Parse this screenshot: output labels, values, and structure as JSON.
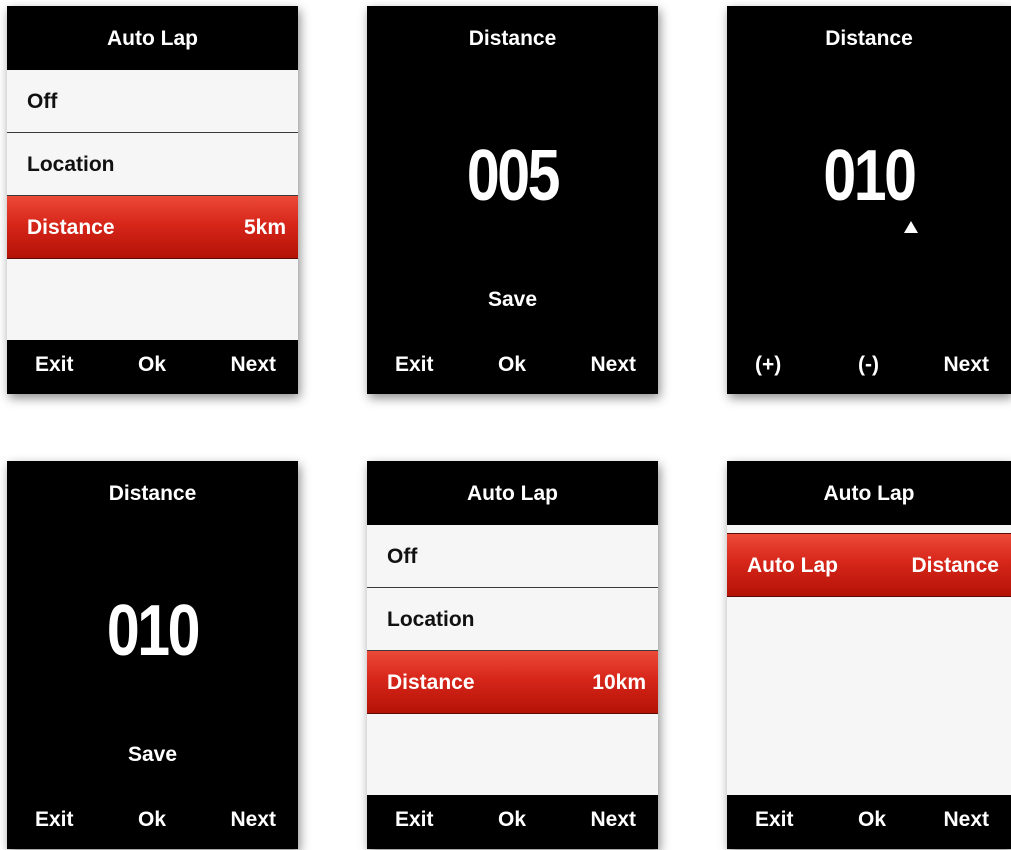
{
  "screens": [
    {
      "title": "Auto Lap",
      "items": [
        {
          "label": "Off",
          "value": ""
        },
        {
          "label": "Location",
          "value": ""
        },
        {
          "label": "Distance",
          "value": "5km"
        }
      ],
      "buttons": [
        "Exit",
        "Ok",
        "Next"
      ]
    },
    {
      "title": "Distance",
      "number": "005",
      "action": "Save",
      "buttons": [
        "Exit",
        "Ok",
        "Next"
      ]
    },
    {
      "title": "Distance",
      "number": "010",
      "buttons": [
        "(+)",
        "(-)",
        "Next"
      ]
    },
    {
      "title": "Distance",
      "number": "010",
      "action": "Save",
      "buttons": [
        "Exit",
        "Ok",
        "Next"
      ]
    },
    {
      "title": "Auto Lap",
      "items": [
        {
          "label": "Off",
          "value": ""
        },
        {
          "label": "Location",
          "value": ""
        },
        {
          "label": "Distance",
          "value": "10km"
        }
      ],
      "buttons": [
        "Exit",
        "Ok",
        "Next"
      ]
    },
    {
      "title": "Auto Lap",
      "items": [
        {
          "label": "Auto Lap",
          "value": "Distance"
        }
      ],
      "buttons": [
        "Exit",
        "Ok",
        "Next"
      ]
    }
  ],
  "colors": {
    "selected": "#d7261a",
    "screen_background": "#000000",
    "list_background": "#f6f6f6"
  }
}
